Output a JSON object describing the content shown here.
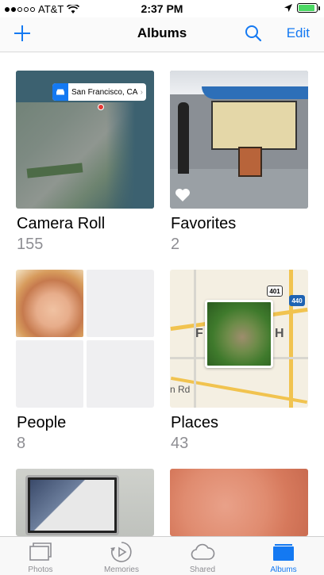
{
  "status_bar": {
    "carrier": "AT&T",
    "time": "2:37 PM"
  },
  "nav": {
    "title": "Albums",
    "edit_label": "Edit"
  },
  "albums": [
    {
      "name": "Camera Roll",
      "count": "155",
      "map_label": "San Francisco, CA"
    },
    {
      "name": "Favorites",
      "count": "2"
    },
    {
      "name": "People",
      "count": "8"
    },
    {
      "name": "Places",
      "count": "43",
      "map_road_label": "n Rd",
      "shields": [
        "401",
        "440"
      ],
      "letters": [
        "F",
        "H"
      ]
    },
    {
      "name": "",
      "count": ""
    },
    {
      "name": "",
      "count": ""
    }
  ],
  "tabs": [
    {
      "label": "Photos",
      "icon": "photos-icon",
      "active": false
    },
    {
      "label": "Memories",
      "icon": "memories-icon",
      "active": false
    },
    {
      "label": "Shared",
      "icon": "cloud-icon",
      "active": false
    },
    {
      "label": "Albums",
      "icon": "albums-icon",
      "active": true
    }
  ],
  "colors": {
    "accent": "#1479f2",
    "battery": "#4cd964",
    "count_gray": "#8e8e93"
  }
}
